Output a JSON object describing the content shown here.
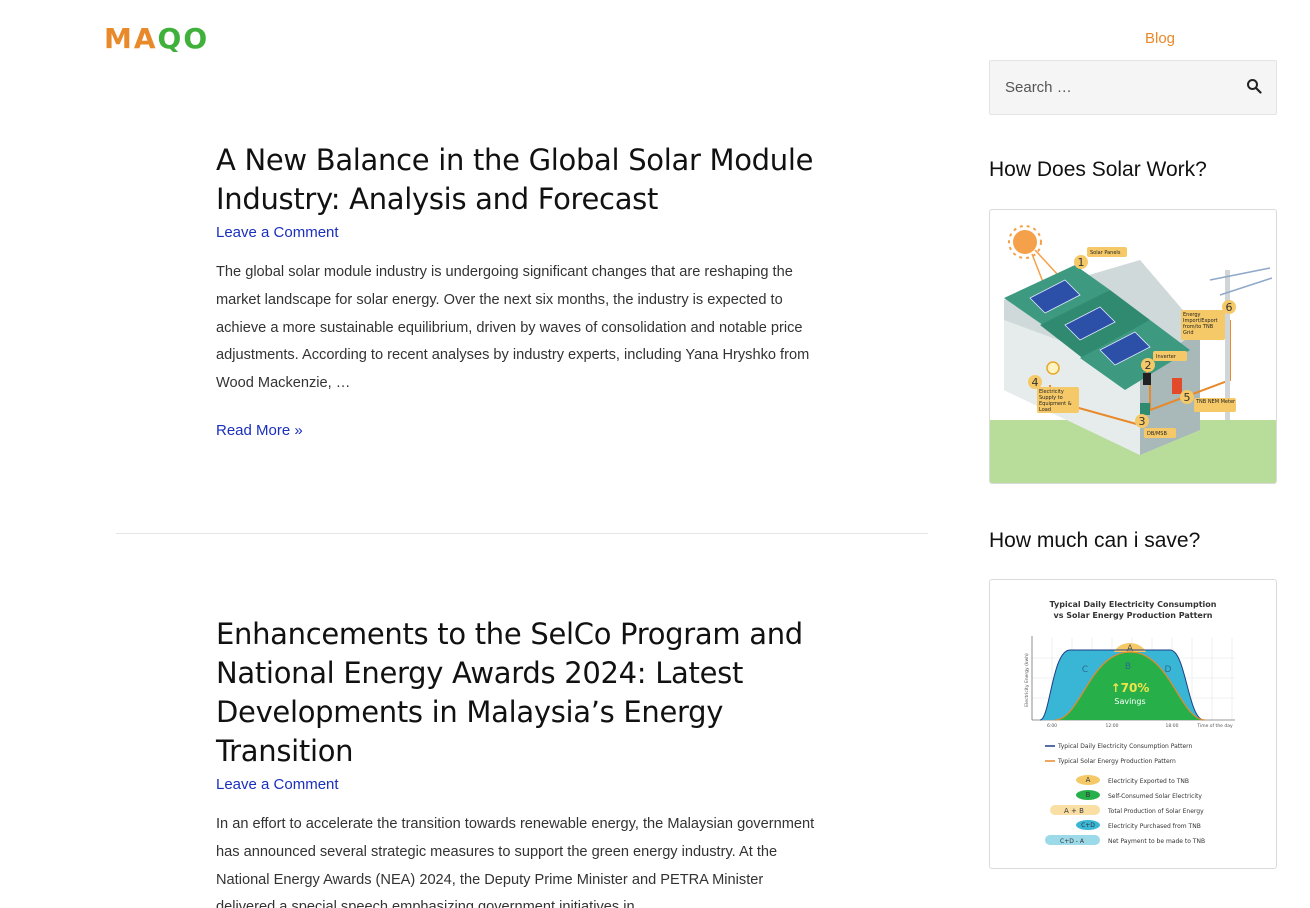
{
  "header": {
    "logo_text": "MAQO",
    "nav": {
      "blog_label": "Blog"
    }
  },
  "posts": [
    {
      "title": "A New Balance in the Global Solar Module Industry: Analysis and Forecast",
      "meta": "Leave a Comment",
      "excerpt": "The global solar module industry is undergoing significant changes that are reshaping the market landscape for solar energy. Over the next six months, the industry is expected to achieve a more sustainable equilibrium, driven by waves of consolidation and notable price adjustments. According to recent analyses by industry experts, including Yana Hryshko from Wood Mackenzie, …",
      "read_more": "Read More »"
    },
    {
      "title": "Enhancements to the SelCo Program and National Energy Awards 2024: Latest Developments in Malaysia’s Energy Transition",
      "meta": "Leave a Comment",
      "excerpt": "In an effort to accelerate the transition towards renewable energy, the Malaysian government has announced several strategic measures to support the green energy industry. At the National Energy Awards (NEA) 2024, the Deputy Prime Minister and PETRA Minister delivered a special speech emphasizing government initiatives in"
    }
  ],
  "sidebar": {
    "search": {
      "placeholder": "Search …"
    },
    "widget1": {
      "title": "How Does Solar Work?",
      "labels": {
        "solar_panels": "Solar Panels",
        "inverter": "Inverter",
        "energy_import_export": "Energy Import/Export from/to TNB Grid",
        "electricity_supply": "Electricity Supply to Equipment & Load",
        "tnb_meter": "TNB NEM Meter",
        "db_msb": "DB/MSB"
      },
      "numbers": [
        "1",
        "2",
        "3",
        "4",
        "5",
        "6"
      ]
    },
    "widget2": {
      "title": "How much can i save?",
      "chart_title_1": "Typical Daily Electricity Consumption",
      "chart_title_2": "vs Solar Energy Production Pattern",
      "y_label": "Electricity Energy (kwh)",
      "x_ticks": [
        "6:00",
        "12:00",
        "18:00"
      ],
      "x_label": "Time of the day",
      "savings_pct": "↑70%",
      "savings_label": "Savings",
      "region_letters": [
        "A",
        "B",
        "C",
        "D"
      ],
      "legend": {
        "consumption": "Typical Daily Electricity Consumption Pattern",
        "production": "Typical Solar Energy Production Pattern",
        "a": "Electricity Exported to TNB",
        "b": "Self-Consumed Solar Electricity",
        "ab": "Total Production of Solar Energy",
        "cd": "Electricity Purchased from TNB",
        "net": "Net Payment to be made to TNB"
      },
      "legend_symbols": {
        "a": "A",
        "b": "B",
        "a_plus_b": "A + B",
        "c_d": "C+D",
        "cd_minus_a": "C+D - A"
      }
    }
  },
  "colors": {
    "logo_orange": "#e8892a",
    "logo_green": "#3fb13a",
    "link_blue": "#1a2fbf",
    "nav_orange": "#e8892a"
  }
}
